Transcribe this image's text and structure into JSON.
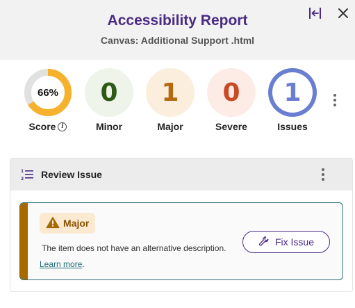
{
  "header": {
    "title": "Accessibility Report",
    "subtitle": "Canvas: Additional Support .html",
    "collapse_icon": "collapse-panel-icon",
    "close_icon": "close-icon"
  },
  "stats": {
    "score": {
      "value_text": "66%",
      "value": 66,
      "label": "Score",
      "info_icon": "info-icon"
    },
    "minor": {
      "value": "0",
      "label": "Minor"
    },
    "major": {
      "value": "1",
      "label": "Major"
    },
    "severe": {
      "value": "0",
      "label": "Severe"
    },
    "issues": {
      "value": "1",
      "label": "Issues"
    }
  },
  "panel": {
    "title": "Review Issue",
    "icon": "numbered-list-icon"
  },
  "issue": {
    "severity": "Major",
    "severity_icon": "warning-icon",
    "description": "The item does not have an alternative description.",
    "learn_more": "Learn more",
    "learn_more_suffix": ".",
    "fix_label": "Fix Issue",
    "fix_icon": "wrench-icon"
  },
  "colors": {
    "brand": "#4a2a83",
    "score_ring": "#f6b12d",
    "minor": "#2f5a14",
    "major": "#b46a10",
    "severe": "#c94a25",
    "issues": "#6a7fd2",
    "major_bar": "#a76a00",
    "card_border": "#2c6e78"
  }
}
